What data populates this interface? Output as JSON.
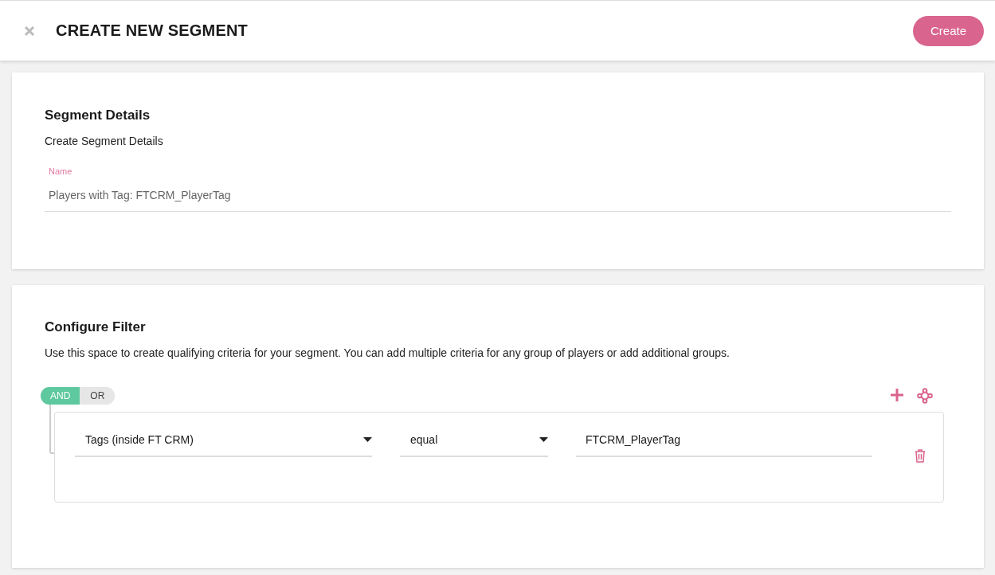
{
  "header": {
    "title": "CREATE NEW SEGMENT",
    "create_button": "Create"
  },
  "details": {
    "title": "Segment Details",
    "subtitle": "Create Segment Details",
    "name_field": {
      "label": "Name",
      "value": "Players with Tag: FTCRM_PlayerTag"
    }
  },
  "filter": {
    "title": "Configure Filter",
    "description": "Use this space to create qualifying criteria for your segment. You can add multiple criteria for any group of players or add additional groups.",
    "operators": [
      {
        "label": "AND",
        "selected": true
      },
      {
        "label": "OR",
        "selected": false
      }
    ],
    "rule": [
      {
        "kind": "select",
        "value": "Tags (inside FT CRM)"
      },
      {
        "kind": "select",
        "value": "equal"
      },
      {
        "kind": "input",
        "value": "FTCRM_PlayerTag"
      }
    ]
  }
}
